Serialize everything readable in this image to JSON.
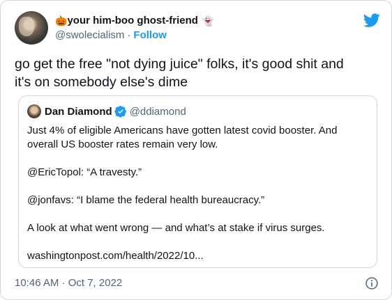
{
  "author": {
    "display_name": "your him-boo ghost-friend",
    "name_prefix_emoji": "🎃",
    "name_suffix_emoji": "👻",
    "handle": "@swolecialism",
    "separator": "·",
    "follow_label": "Follow"
  },
  "tweet": {
    "text_line1": "go get the free \"not dying juice\" folks, it's good shit and",
    "text_line2": "it's on somebody else's dime"
  },
  "quoted_tweet": {
    "display_name": "Dan Diamond",
    "handle": "@ddiamond",
    "paragraphs": [
      "Just 4% of eligible Americans have gotten latest covid booster. And overall US booster rates remain very low.",
      "@EricTopol: “A travesty.”",
      "@jonfavs: “I blame the federal health bureaucracy.”",
      "A look at what went wrong — and what’s at stake if virus surges.",
      "washingtonpost.com/health/2022/10..."
    ]
  },
  "footer": {
    "timestamp": "10:46 AM · Oct 7, 2022"
  },
  "colors": {
    "accent": "#1d9bf0",
    "text": "#0f1419",
    "secondary": "#536471",
    "border": "#cfd9de"
  },
  "icons": {
    "brand": "twitter-bird-icon",
    "verified": "verified-badge-icon",
    "info": "info-icon"
  }
}
